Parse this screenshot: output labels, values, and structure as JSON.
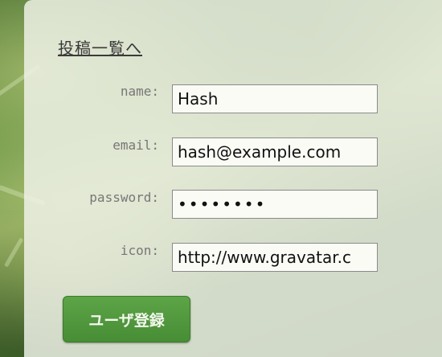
{
  "nav": {
    "back_link": "投稿一覧へ"
  },
  "form": {
    "name_label": "name:",
    "name_value": "Hash",
    "email_label": "email:",
    "email_value": "hash@example.com",
    "password_label": "password:",
    "password_value": "••••••••",
    "icon_label": "icon:",
    "icon_value": "http://www.gravatar.c",
    "submit_label": "ユーザ登録"
  },
  "colors": {
    "accent": "#4f9a3c",
    "panel": "#f0f2e8",
    "label_text": "#777777"
  }
}
